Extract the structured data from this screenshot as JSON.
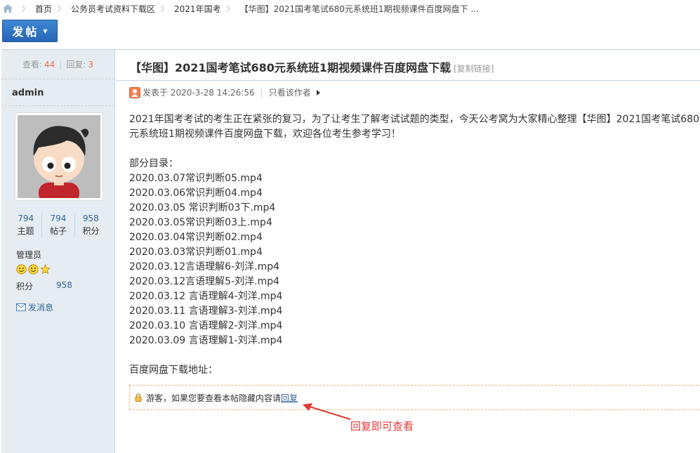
{
  "breadcrumb": {
    "items": [
      "首页",
      "公务员考试资料下载区",
      "2021年国考"
    ],
    "current": "【华图】2021国考笔试680元系统班1期视频课件百度网盘下 ..."
  },
  "toolbar": {
    "post_label": "发帖"
  },
  "sidebar": {
    "views_label": "查看:",
    "views": "44",
    "replies_label": "回复:",
    "replies": "3",
    "author": "admin",
    "counts": [
      {
        "value": "794",
        "label": "主题"
      },
      {
        "value": "794",
        "label": "帖子"
      },
      {
        "value": "958",
        "label": "积分"
      }
    ],
    "role": "管理员",
    "points_label": "积分",
    "points_value": "958",
    "send_msg": "发消息"
  },
  "post": {
    "title": "【华图】2021国考笔试680元系统班1期视频课件百度网盘下载",
    "copy_link": "[复制链接]",
    "meta_prefix": "发表于 2020-3-28 14:26:56",
    "only_author": "只看该作者",
    "intro": "2021年国考考试的考生正在紧张的复习，为了让考生了解考试试题的类型，今天公考窝为大家精心整理【华图】2021国考笔试680元系统班1期视频课件百度网盘下载，欢迎各位考生参考学习！",
    "toc_heading": "部分目录：",
    "files": [
      "2020.03.07常识判断05.mp4",
      "2020.03.06常识判断04.mp4",
      "2020.03.05 常识判断03下.mp4",
      "2020.03.05常识判断03上.mp4",
      "2020.03.04常识判断02.mp4",
      "2020.03.03常识判断01.mp4",
      "2020.03.12言语理解6-刘洋.mp4",
      "2020.03.12言语理解5-刘洋.mp4",
      "2020.03.12 言语理解4-刘洋.mp4",
      "2020.03.11 言语理解3-刘洋.mp4",
      "2020.03.10 言语理解2-刘洋.mp4",
      "2020.03.09 言语理解1-刘洋.mp4"
    ],
    "download_label": "百度网盘下载地址：",
    "locked_text": "游客，如果您要查看本帖隐藏内容请",
    "locked_link": "回复",
    "annotation": "回复即可查看"
  },
  "colors": {
    "accent": "#2566b4",
    "link": "#336699",
    "warning": "#e03a3a",
    "number": "#f26c4f"
  }
}
